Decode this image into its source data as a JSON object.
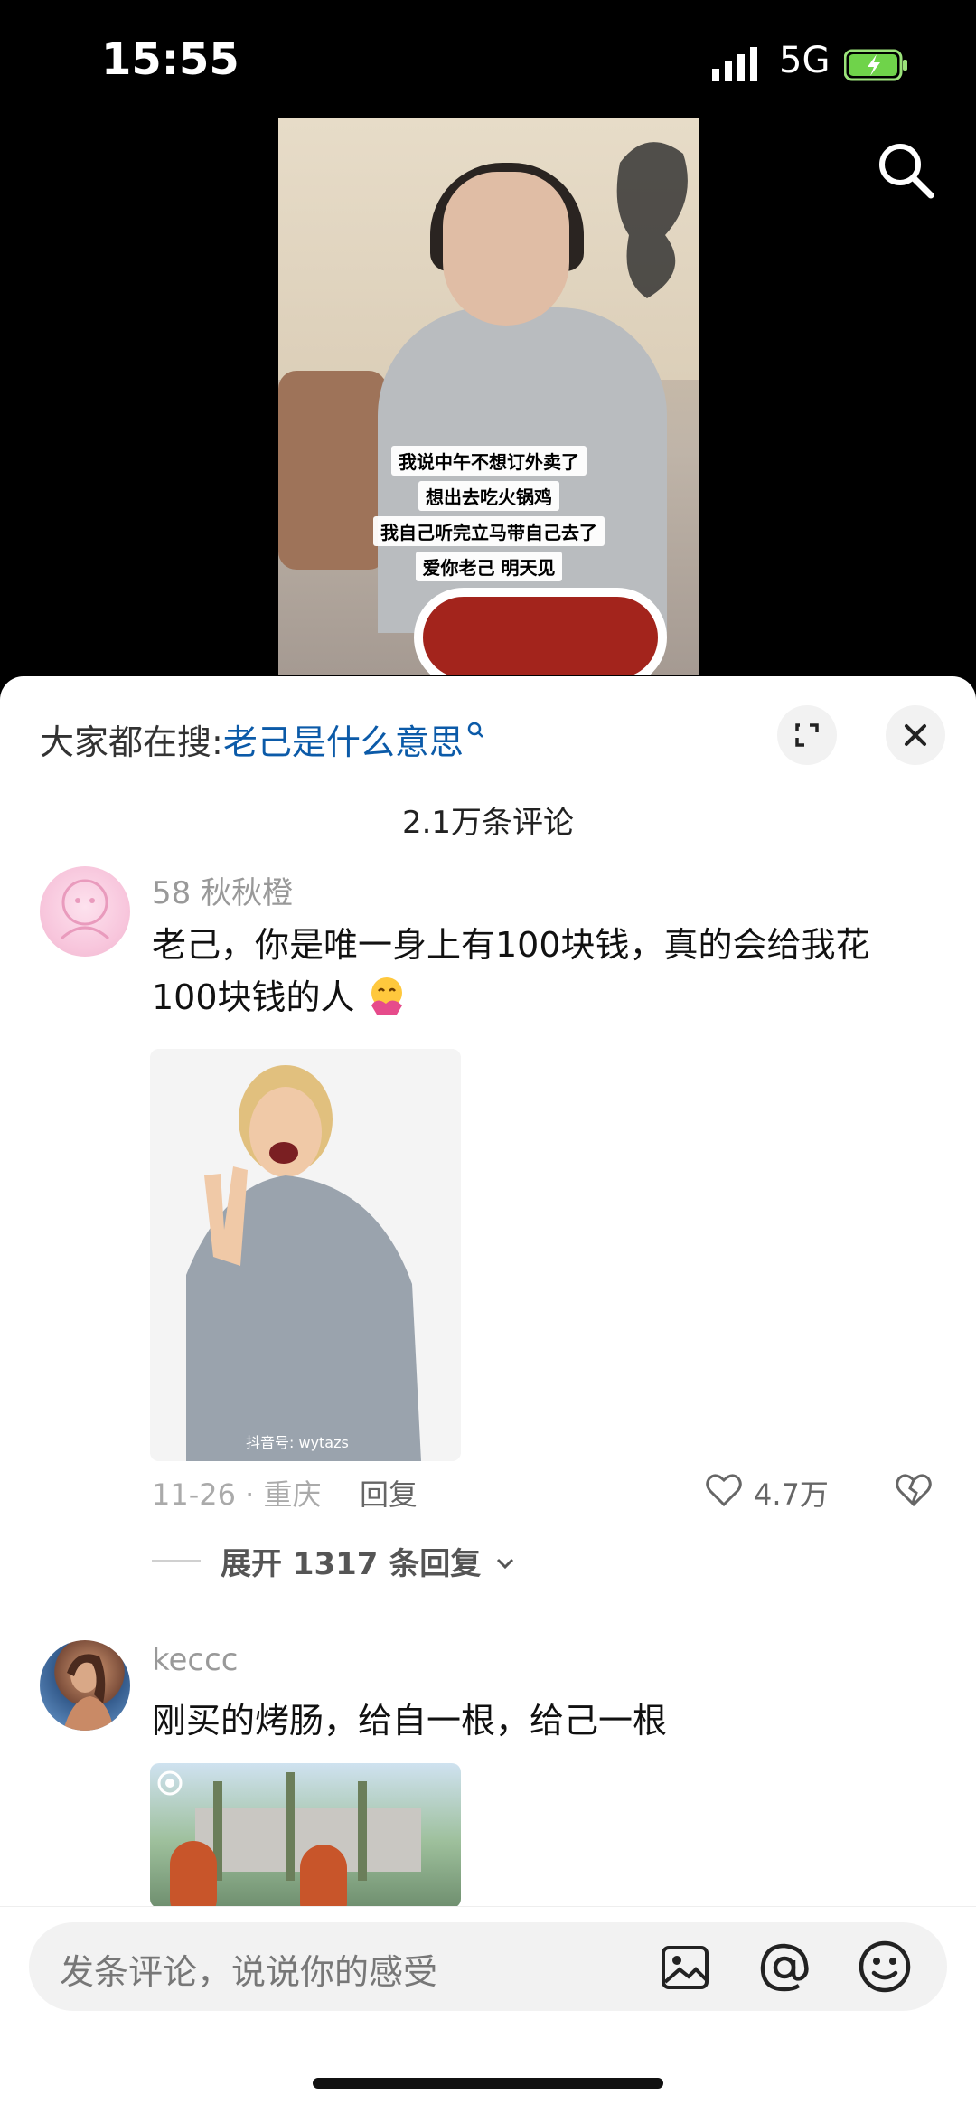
{
  "status_bar": {
    "time": "15:55",
    "network": "5G"
  },
  "video": {
    "subtitles": [
      "我说中午不想订外卖了",
      "想出去吃火锅鸡",
      "我自己听完立马带自己去了",
      "爱你老己 明天见"
    ]
  },
  "comment_sheet": {
    "search_hint_prefix": "大家都在搜:",
    "search_hint_keyword": "老己是什么意思",
    "comment_count": "2.1万条评论",
    "comments": [
      {
        "username": "58 秋秋橙",
        "text": "老己，你是唯一身上有100块钱，真的会给我花100块钱的人",
        "image_watermark": "抖音号: wytazs",
        "date_location": "11-26 · 重庆",
        "reply_label": "回复",
        "likes": "4.7万",
        "expand_replies": "展开 1317 条回复"
      },
      {
        "username": "keccc",
        "text": "刚买的烤肠，给自一根，给己一根"
      }
    ]
  },
  "input": {
    "placeholder": "发条评论，说说你的感受"
  },
  "colors": {
    "keyword_link": "#0b5aa8",
    "sheet_bg": "#ffffff",
    "video_bg": "#000000"
  }
}
